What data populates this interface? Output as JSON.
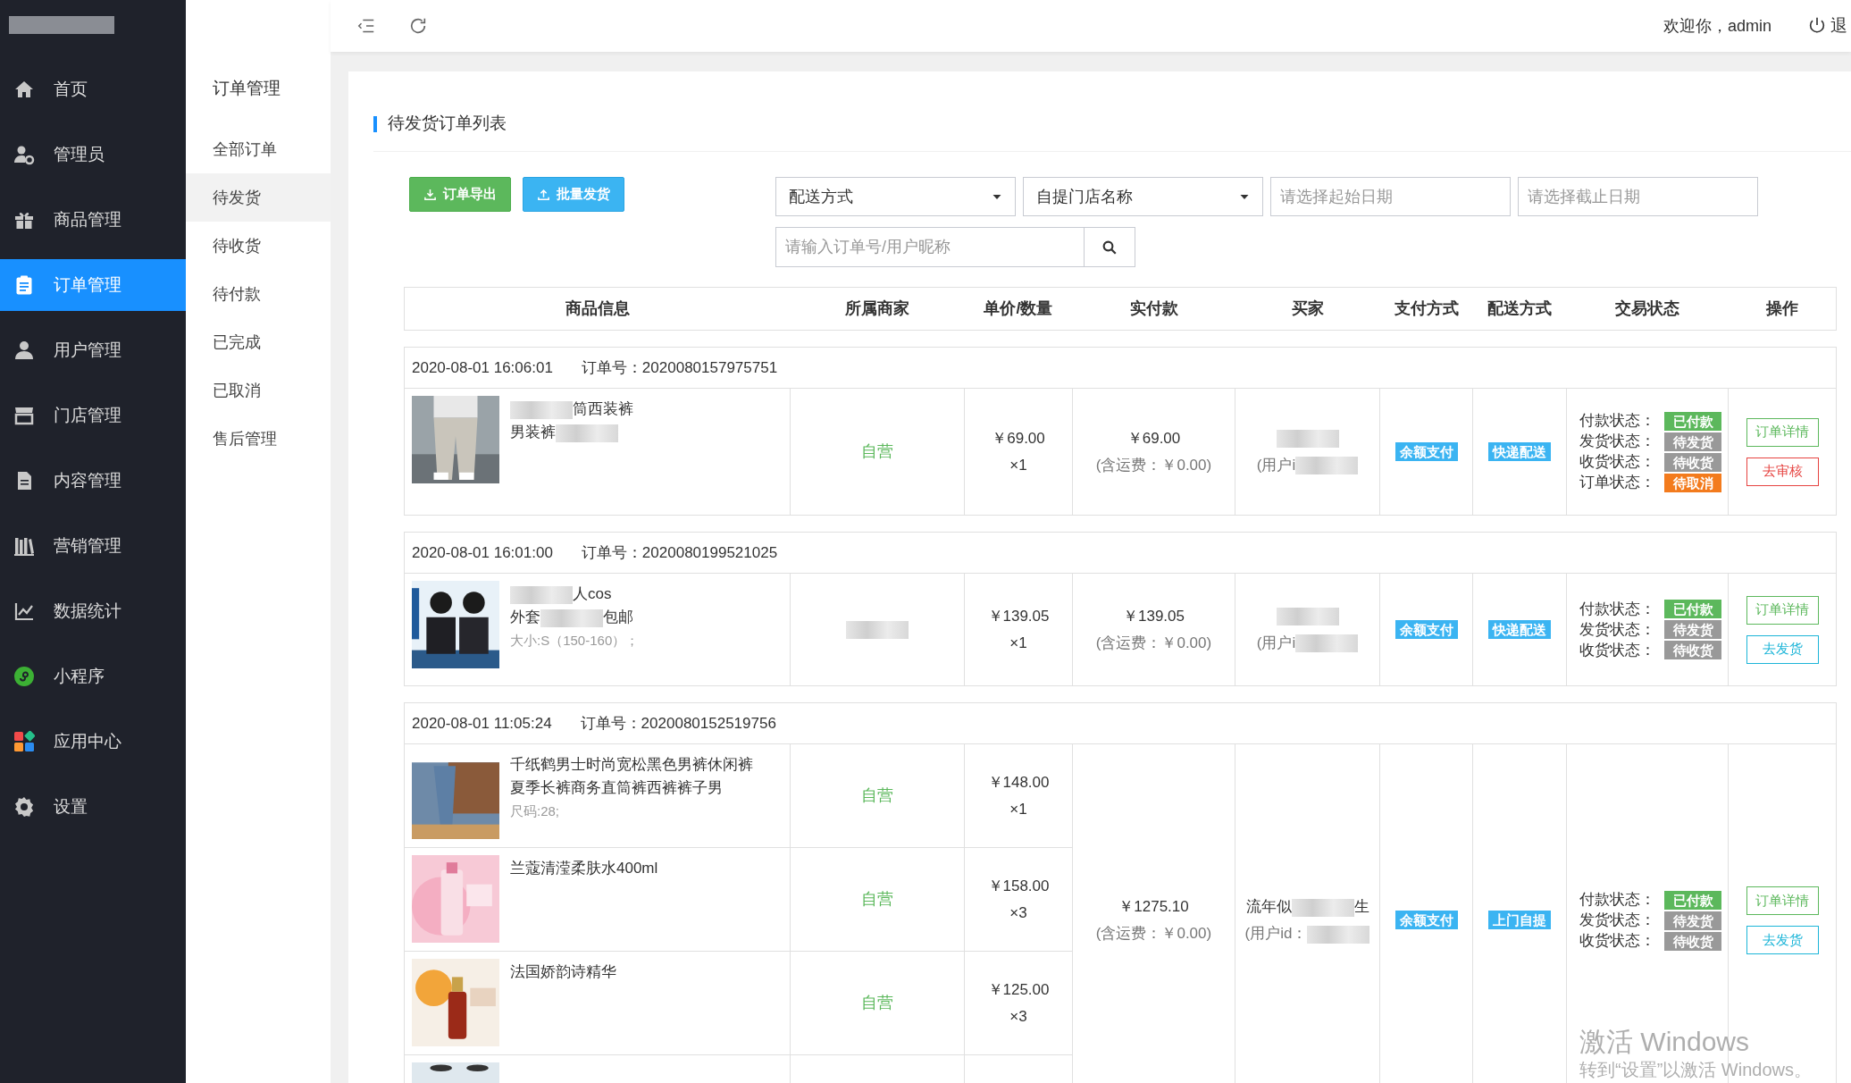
{
  "sidebar": {
    "items": [
      {
        "label": "首页",
        "selected": false
      },
      {
        "label": "管理员",
        "selected": false
      },
      {
        "label": "商品管理",
        "selected": false
      },
      {
        "label": "订单管理",
        "selected": true
      },
      {
        "label": "用户管理",
        "selected": false
      },
      {
        "label": "门店管理",
        "selected": false
      },
      {
        "label": "内容管理",
        "selected": false
      },
      {
        "label": "营销管理",
        "selected": false
      },
      {
        "label": "数据统计",
        "selected": false
      },
      {
        "label": "小程序",
        "selected": false
      },
      {
        "label": "应用中心",
        "selected": false
      },
      {
        "label": "设置",
        "selected": false
      }
    ]
  },
  "submenu": {
    "title": "订单管理",
    "items": [
      {
        "label": "全部订单",
        "selected": false
      },
      {
        "label": "待发货",
        "selected": true
      },
      {
        "label": "待收货",
        "selected": false
      },
      {
        "label": "待付款",
        "selected": false
      },
      {
        "label": "已完成",
        "selected": false
      },
      {
        "label": "已取消",
        "selected": false
      },
      {
        "label": "售后管理",
        "selected": false
      }
    ]
  },
  "header": {
    "welcome": "欢迎你，admin",
    "logout": "退"
  },
  "card": {
    "title": "待发货订单列表",
    "buttons": [
      {
        "label": "订单导出",
        "kind": "export"
      },
      {
        "label": "批量发货",
        "kind": "upload"
      }
    ],
    "selects": [
      {
        "value": "配送方式"
      },
      {
        "value": "自提门店名称"
      }
    ],
    "date_fields": [
      {
        "placeholder": "请选择起始日期"
      },
      {
        "placeholder": "请选择截止日期"
      }
    ],
    "search": {
      "placeholder": "请输入订单号/用户昵称"
    }
  },
  "table": {
    "columns": [
      "商品信息",
      "所属商家",
      "单价/数量",
      "实付款",
      "买家",
      "支付方式",
      "配送方式",
      "交易状态",
      "操作"
    ],
    "orders": [
      {
        "time": "2020-08-01 16:06:01",
        "order_no_label": "订单号：",
        "order_no": "2020080157975751",
        "products": [
          {
            "kind": "full",
            "name_lines": [
              [
                {
                  "kind": "redacted"
                },
                {
                  "text": "筒西装裤"
                }
              ],
              [
                {
                  "text": "男装裤"
                },
                {
                  "kind": "redacted"
                }
              ]
            ],
            "merchant": [
              {
                "text": "自营"
              }
            ],
            "price": "￥69.00",
            "qty": "×1"
          }
        ],
        "paid": "￥69.00",
        "shipping": "(含运费：￥0.00)",
        "buyer": [
          [
            {
              "kind": "redacted"
            }
          ],
          [
            {
              "text": "(用户i"
            },
            {
              "kind": "redacted"
            }
          ]
        ],
        "payment": "余额支付",
        "delivery": "快递配送",
        "statuses": [
          {
            "label": "付款状态：",
            "value": "已付款",
            "color": "#5cb85c"
          },
          {
            "label": "发货状态：",
            "value": "待发货",
            "color": "#999999"
          },
          {
            "label": "收货状态：",
            "value": "待收货",
            "color": "#999999"
          },
          {
            "label": "订单状态：",
            "value": "待取消",
            "color": "#f37b1d"
          }
        ],
        "actions": [
          {
            "label": "订单详情",
            "color": "#5cb85c"
          },
          {
            "label": "去审核",
            "color": "#e64340"
          }
        ]
      },
      {
        "time": "2020-08-01 16:01:00",
        "order_no_label": "订单号：",
        "order_no": "2020080199521025",
        "products": [
          {
            "kind": "full",
            "name_lines": [
              [
                {
                  "kind": "redacted"
                },
                {
                  "text": "人cos"
                }
              ],
              [
                {
                  "text": "外套"
                },
                {
                  "kind": "redacted"
                },
                {
                  "text": "包邮"
                }
              ]
            ],
            "spec": "大小:S（150-160）；",
            "merchant": [
              {
                "kind": "redacted"
              }
            ],
            "price": "￥139.05",
            "qty": "×1"
          }
        ],
        "paid": "￥139.05",
        "shipping": "(含运费：￥0.00)",
        "buyer": [
          [
            {
              "kind": "redacted"
            }
          ],
          [
            {
              "text": "(用户i"
            },
            {
              "kind": "redacted"
            }
          ]
        ],
        "payment": "余额支付",
        "delivery": "快递配送",
        "statuses": [
          {
            "label": "付款状态：",
            "value": "已付款",
            "color": "#5cb85c"
          },
          {
            "label": "发货状态：",
            "value": "待发货",
            "color": "#999999"
          },
          {
            "label": "收货状态：",
            "value": "待收货",
            "color": "#999999"
          }
        ],
        "actions": [
          {
            "label": "订单详情",
            "color": "#5cb85c"
          },
          {
            "label": "去发货",
            "color": "#1cb5d8"
          }
        ]
      },
      {
        "time": "2020-08-01 11:05:24",
        "order_no_label": "订单号：",
        "order_no": "2020080152519756",
        "products": [
          {
            "kind": "full",
            "name_lines": [
              [
                {
                  "text": "千纸鹤男士时尚宽松黑色男裤休闲裤"
                }
              ],
              [
                {
                  "text": "夏季长裤商务直筒裤西裤裤子男"
                }
              ]
            ],
            "spec": "尺码:28;",
            "merchant": [
              {
                "text": "自营"
              }
            ],
            "price": "￥148.00",
            "qty": "×1"
          },
          {
            "kind": "full",
            "name_lines": [
              [
                {
                  "text": "兰蔻清滢柔肤水400ml"
                }
              ]
            ],
            "merchant": [
              {
                "text": "自营"
              }
            ],
            "price": "￥158.00",
            "qty": "×3"
          },
          {
            "kind": "full",
            "name_lines": [
              [
                {
                  "text": "法国娇韵诗精华"
                }
              ]
            ],
            "merchant": [
              {
                "text": "自营"
              }
            ],
            "price": "￥125.00",
            "qty": "×3"
          },
          {
            "kind": "cut"
          }
        ],
        "paid": "￥1275.10",
        "shipping": "(含运费：￥0.00)",
        "buyer": [
          [
            {
              "text": "流年似"
            },
            {
              "kind": "redacted"
            },
            {
              "text": "生"
            }
          ],
          [
            {
              "text": "(用户id："
            },
            {
              "kind": "redacted"
            }
          ]
        ],
        "payment": "余额支付",
        "delivery": "上门自提",
        "statuses": [
          {
            "label": "付款状态：",
            "value": "已付款",
            "color": "#5cb85c"
          },
          {
            "label": "发货状态：",
            "value": "待发货",
            "color": "#999999"
          },
          {
            "label": "收货状态：",
            "value": "待收货",
            "color": "#999999"
          }
        ],
        "actions": [
          {
            "label": "订单详情",
            "color": "#5cb85c"
          },
          {
            "label": "去发货",
            "color": "#1cb5d8"
          }
        ]
      }
    ]
  },
  "os_notice": {
    "title": "激活 Windows",
    "subtitle": "转到“设置”以激活 Windows。"
  }
}
